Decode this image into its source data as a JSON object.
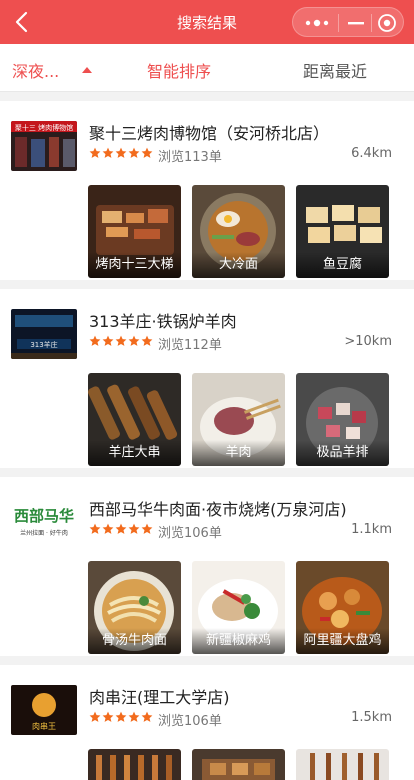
{
  "header": {
    "title": "搜索结果"
  },
  "filters": {
    "area": "深夜...",
    "sort": "智能排序",
    "distance": "距离最近"
  },
  "colors": {
    "accent": "#ee4f4f",
    "star": "#f26b1d"
  },
  "stores": [
    {
      "name": "聚十三烤肉博物馆（安河桥北店）",
      "thumb_text": "聚十三 烤肉博物馆",
      "rating": 5,
      "views": "浏览113单",
      "distance": "6.4km",
      "dishes": [
        "烤肉十三大梯",
        "大冷面",
        "鱼豆腐"
      ]
    },
    {
      "name": "313羊庄·铁锅炉羊肉",
      "thumb_text": "313羊庄",
      "rating": 5,
      "views": "浏览112单",
      "distance": ">10km",
      "dishes": [
        "羊庄大串",
        "羊肉",
        "极品羊排"
      ]
    },
    {
      "name": "西部马华牛肉面·夜市烧烤(万泉河店)",
      "thumb_text": "西部马华",
      "thumb_sub": "兰州拉面 · 好牛肉",
      "rating": 5,
      "views": "浏览106单",
      "distance": "1.1km",
      "dishes": [
        "骨汤牛肉面",
        "新疆椒麻鸡",
        "阿里疆大盘鸡"
      ]
    },
    {
      "name": "肉串汪(理工大学店)",
      "thumb_text": "肉串王",
      "rating": 5,
      "views": "浏览106单",
      "distance": "1.5km",
      "dishes": []
    }
  ]
}
